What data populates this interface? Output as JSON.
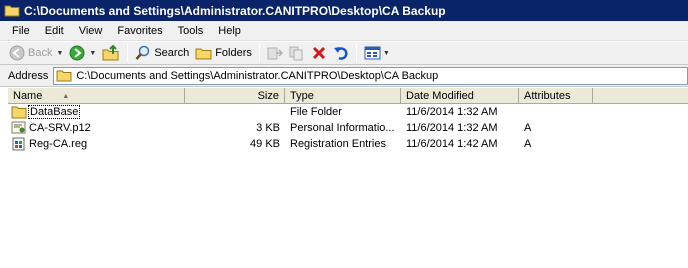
{
  "window": {
    "title": "C:\\Documents and Settings\\Administrator.CANITPRO\\Desktop\\CA Backup"
  },
  "menu": [
    {
      "label": "File"
    },
    {
      "label": "Edit"
    },
    {
      "label": "View"
    },
    {
      "label": "Favorites"
    },
    {
      "label": "Tools"
    },
    {
      "label": "Help"
    }
  ],
  "toolbar": {
    "back_label": "Back",
    "search_label": "Search",
    "folders_label": "Folders"
  },
  "address": {
    "label": "Address",
    "value": "C:\\Documents and Settings\\Administrator.CANITPRO\\Desktop\\CA Backup"
  },
  "columns": {
    "name": "Name",
    "size": "Size",
    "type": "Type",
    "date": "Date Modified",
    "attributes": "Attributes"
  },
  "files": [
    {
      "name": "DataBase",
      "size": "",
      "type": "File Folder",
      "date": "11/6/2014 1:32 AM",
      "attributes": "",
      "icon": "folder-icon"
    },
    {
      "name": "CA-SRV.p12",
      "size": "3 KB",
      "type": "Personal Informatio...",
      "date": "11/6/2014 1:32 AM",
      "attributes": "A",
      "icon": "certificate-icon"
    },
    {
      "name": "Reg-CA.reg",
      "size": "49 KB",
      "type": "Registration Entries",
      "date": "11/6/2014 1:42 AM",
      "attributes": "A",
      "icon": "registry-icon"
    }
  ],
  "colors": {
    "titlebar": "#0a246a",
    "folder": "#f5c842"
  }
}
